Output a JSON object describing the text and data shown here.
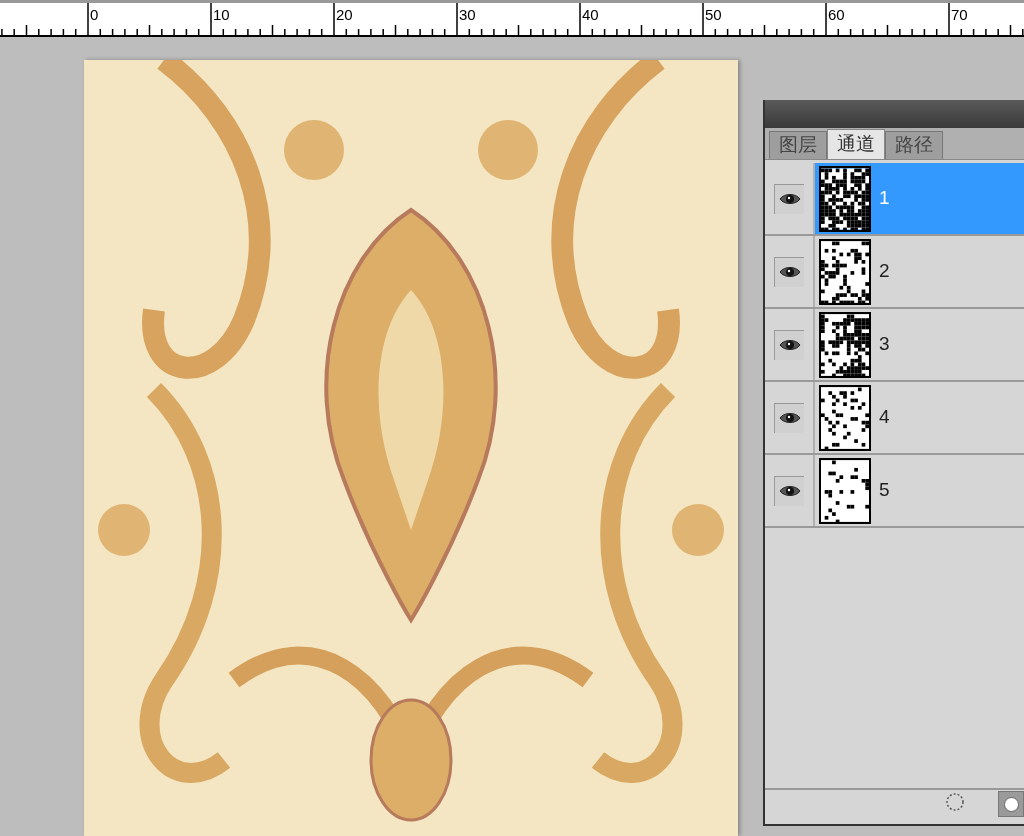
{
  "ruler": {
    "labels": [
      "0",
      "10",
      "20",
      "30",
      "40",
      "50",
      "60",
      "70"
    ]
  },
  "channels_panel": {
    "tabs": [
      {
        "label": "图层",
        "selected": false
      },
      {
        "label": "通道",
        "selected": true
      },
      {
        "label": "路径",
        "selected": false
      }
    ],
    "channels": [
      {
        "name": "1",
        "selected": true,
        "visible": true
      },
      {
        "name": "2",
        "selected": false,
        "visible": true
      },
      {
        "name": "3",
        "selected": false,
        "visible": true
      },
      {
        "name": "4",
        "selected": false,
        "visible": true
      },
      {
        "name": "5",
        "selected": false,
        "visible": true
      }
    ]
  }
}
